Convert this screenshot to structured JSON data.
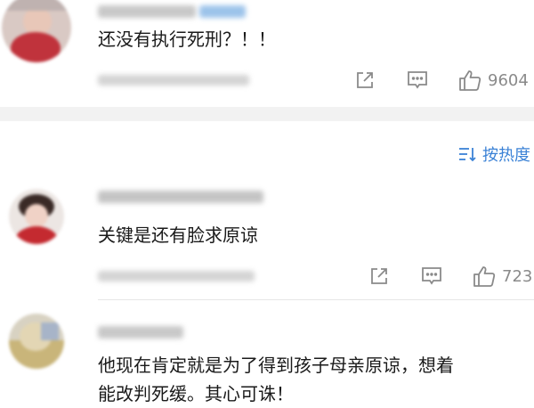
{
  "comments": [
    {
      "text": "还没有执行死刑？！！",
      "likes": "9604"
    },
    {
      "text": "关键是还有脸求原谅",
      "likes": "723"
    },
    {
      "text_line1": "他现在肯定就是为了得到孩子母亲原谅，想着",
      "text_line2": "能改判死缓。其心可诛！"
    }
  ],
  "sort_label": "按热度"
}
